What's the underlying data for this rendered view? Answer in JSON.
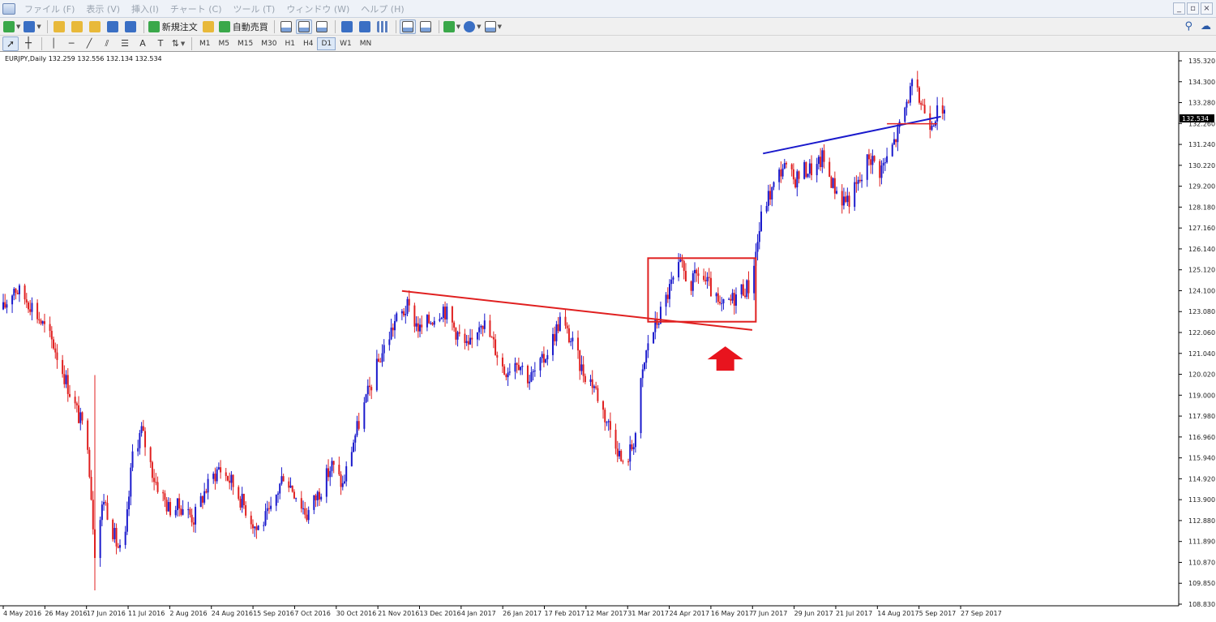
{
  "menubar": {
    "items": [
      "ファイル (F)",
      "表示 (V)",
      "挿入(I)",
      "チャート (C)",
      "ツール (T)",
      "ウィンドウ (W)",
      "ヘルプ (H)"
    ],
    "window_buttons": [
      "_",
      "▫",
      "×"
    ]
  },
  "toolbar": {
    "new_order_label": "新規注文",
    "auto_trade_label": "自動売買"
  },
  "draw_toolbar": {
    "text_tool_label": "A",
    "timeframes": [
      "M1",
      "M5",
      "M15",
      "M30",
      "H1",
      "H4",
      "D1",
      "W1",
      "MN"
    ],
    "active_timeframe": "D1"
  },
  "chart": {
    "header": "EURJPY,Daily  132.259 132.556 132.134 132.534",
    "current_price": "132.534",
    "price_axis": [
      "135.320",
      "134.300",
      "133.280",
      "132.260",
      "131.240",
      "130.220",
      "129.200",
      "128.180",
      "127.160",
      "126.140",
      "125.120",
      "124.100",
      "123.080",
      "122.060",
      "121.040",
      "120.020",
      "119.000",
      "117.980",
      "116.960",
      "115.940",
      "114.920",
      "113.900",
      "112.880",
      "111.890",
      "110.870",
      "109.850",
      "108.830"
    ],
    "date_axis": [
      "4 May 2016",
      "26 May 2016",
      "17 Jun 2016",
      "11 Jul 2016",
      "2 Aug 2016",
      "24 Aug 2016",
      "15 Sep 2016",
      "7 Oct 2016",
      "30 Oct 2016",
      "21 Nov 2016",
      "13 Dec 2016",
      "4 Jan 2017",
      "26 Jan 2017",
      "17 Feb 2017",
      "12 Mar 2017",
      "31 Mar 2017",
      "24 Apr 2017",
      "16 May 2017",
      "7 Jun 2017",
      "29 Jun 2017",
      "21 Jul 2017",
      "14 Aug 2017",
      "5 Sep 2017",
      "27 Sep 2017"
    ],
    "colors": {
      "bull": "#1a1acc",
      "bear": "#e02020",
      "trendline_red": "#e02020",
      "trendline_blue": "#1a1acc",
      "box": "#e02020",
      "arrow": "#e8141e"
    }
  },
  "chart_data": {
    "type": "candlestick",
    "symbol": "EURJPY",
    "timeframe": "Daily",
    "ohlc_header": {
      "open": 132.259,
      "high": 132.556,
      "low": 132.134,
      "close": 132.534
    },
    "ylim": [
      108.83,
      135.32
    ],
    "path_points": [
      {
        "date": "2016-05-04",
        "price": 123.2
      },
      {
        "date": "2016-05-10",
        "price": 124.3
      },
      {
        "date": "2016-05-20",
        "price": 123.4
      },
      {
        "date": "2016-06-01",
        "price": 121.5
      },
      {
        "date": "2016-06-10",
        "price": 119.2
      },
      {
        "date": "2016-06-20",
        "price": 116.8
      },
      {
        "date": "2016-06-24",
        "price": 111.5
      },
      {
        "date": "2016-06-29",
        "price": 114.0
      },
      {
        "date": "2016-07-06",
        "price": 111.8
      },
      {
        "date": "2016-07-10",
        "price": 111.0
      },
      {
        "date": "2016-07-15",
        "price": 116.2
      },
      {
        "date": "2016-07-20",
        "price": 117.3
      },
      {
        "date": "2016-07-27",
        "price": 115.0
      },
      {
        "date": "2016-08-04",
        "price": 113.5
      },
      {
        "date": "2016-08-12",
        "price": 113.6
      },
      {
        "date": "2016-08-18",
        "price": 113.0
      },
      {
        "date": "2016-08-24",
        "price": 114.3
      },
      {
        "date": "2016-09-01",
        "price": 115.5
      },
      {
        "date": "2016-09-08",
        "price": 114.8
      },
      {
        "date": "2016-09-16",
        "price": 113.5
      },
      {
        "date": "2016-09-22",
        "price": 112.5
      },
      {
        "date": "2016-09-30",
        "price": 113.3
      },
      {
        "date": "2016-10-07",
        "price": 115.2
      },
      {
        "date": "2016-10-14",
        "price": 114.2
      },
      {
        "date": "2016-10-20",
        "price": 113.2
      },
      {
        "date": "2016-10-28",
        "price": 114.5
      },
      {
        "date": "2016-11-03",
        "price": 115.6
      },
      {
        "date": "2016-11-09",
        "price": 114.6
      },
      {
        "date": "2016-11-15",
        "price": 116.8
      },
      {
        "date": "2016-11-22",
        "price": 118.8
      },
      {
        "date": "2016-11-30",
        "price": 120.9
      },
      {
        "date": "2016-12-08",
        "price": 122.6
      },
      {
        "date": "2016-12-15",
        "price": 123.3
      },
      {
        "date": "2016-12-22",
        "price": 122.2
      },
      {
        "date": "2016-12-29",
        "price": 122.8
      },
      {
        "date": "2017-01-04",
        "price": 123.3
      },
      {
        "date": "2017-01-12",
        "price": 122.0
      },
      {
        "date": "2017-01-18",
        "price": 121.2
      },
      {
        "date": "2017-01-25",
        "price": 122.8
      },
      {
        "date": "2017-02-01",
        "price": 121.5
      },
      {
        "date": "2017-02-07",
        "price": 120.2
      },
      {
        "date": "2017-02-14",
        "price": 120.8
      },
      {
        "date": "2017-02-21",
        "price": 119.8
      },
      {
        "date": "2017-02-28",
        "price": 120.6
      },
      {
        "date": "2017-03-06",
        "price": 121.8
      },
      {
        "date": "2017-03-10",
        "price": 122.7
      },
      {
        "date": "2017-03-16",
        "price": 121.7
      },
      {
        "date": "2017-03-22",
        "price": 120.3
      },
      {
        "date": "2017-03-29",
        "price": 119.5
      },
      {
        "date": "2017-04-04",
        "price": 118.0
      },
      {
        "date": "2017-04-10",
        "price": 116.8
      },
      {
        "date": "2017-04-14",
        "price": 115.5
      },
      {
        "date": "2017-04-19",
        "price": 116.5
      },
      {
        "date": "2017-04-21",
        "price": 117.2
      },
      {
        "date": "2017-04-24",
        "price": 119.5
      },
      {
        "date": "2017-04-28",
        "price": 121.6
      },
      {
        "date": "2017-05-04",
        "price": 122.8
      },
      {
        "date": "2017-05-10",
        "price": 124.2
      },
      {
        "date": "2017-05-16",
        "price": 125.3
      },
      {
        "date": "2017-05-22",
        "price": 124.4
      },
      {
        "date": "2017-05-26",
        "price": 125.0
      },
      {
        "date": "2017-06-01",
        "price": 124.3
      },
      {
        "date": "2017-06-07",
        "price": 123.2
      },
      {
        "date": "2017-06-13",
        "price": 123.6
      },
      {
        "date": "2017-06-19",
        "price": 124.2
      },
      {
        "date": "2017-06-23",
        "price": 124.3
      },
      {
        "date": "2017-06-27",
        "price": 126.0
      },
      {
        "date": "2017-07-01",
        "price": 128.2
      },
      {
        "date": "2017-07-06",
        "price": 129.0
      },
      {
        "date": "2017-07-12",
        "price": 130.2
      },
      {
        "date": "2017-07-18",
        "price": 129.5
      },
      {
        "date": "2017-07-24",
        "price": 130.0
      },
      {
        "date": "2017-07-31",
        "price": 130.1
      },
      {
        "date": "2017-08-03",
        "price": 130.6
      },
      {
        "date": "2017-08-09",
        "price": 129.3
      },
      {
        "date": "2017-08-14",
        "price": 128.6
      },
      {
        "date": "2017-08-18",
        "price": 128.6
      },
      {
        "date": "2017-08-25",
        "price": 129.6
      },
      {
        "date": "2017-08-29",
        "price": 130.7
      },
      {
        "date": "2017-09-04",
        "price": 130.0
      },
      {
        "date": "2017-09-08",
        "price": 130.5
      },
      {
        "date": "2017-09-14",
        "price": 131.8
      },
      {
        "date": "2017-09-20",
        "price": 133.6
      },
      {
        "date": "2017-09-22",
        "price": 134.0
      },
      {
        "date": "2017-09-27",
        "price": 133.3
      },
      {
        "date": "2017-10-02",
        "price": 132.4
      },
      {
        "date": "2017-10-06",
        "price": 132.8
      },
      {
        "date": "2017-10-10",
        "price": 132.5
      }
    ],
    "annotations": [
      {
        "type": "trendline",
        "color": "red",
        "from": {
          "date": "2016-12-12",
          "price": 124.1
        },
        "to": {
          "date": "2017-06-25",
          "price": 122.2
        }
      },
      {
        "type": "rectangle",
        "color": "red",
        "from": {
          "date": "2017-04-28",
          "price": 125.7
        },
        "to": {
          "date": "2017-06-27",
          "price": 122.6
        }
      },
      {
        "type": "arrow-up",
        "color": "red",
        "at": {
          "date": "2017-06-10",
          "price": 121.4
        }
      },
      {
        "type": "trendline",
        "color": "blue",
        "from": {
          "date": "2017-07-01",
          "price": 130.8
        },
        "to": {
          "date": "2017-10-08",
          "price": 132.6
        }
      },
      {
        "type": "hline",
        "color": "red",
        "price": 132.25
      }
    ]
  }
}
